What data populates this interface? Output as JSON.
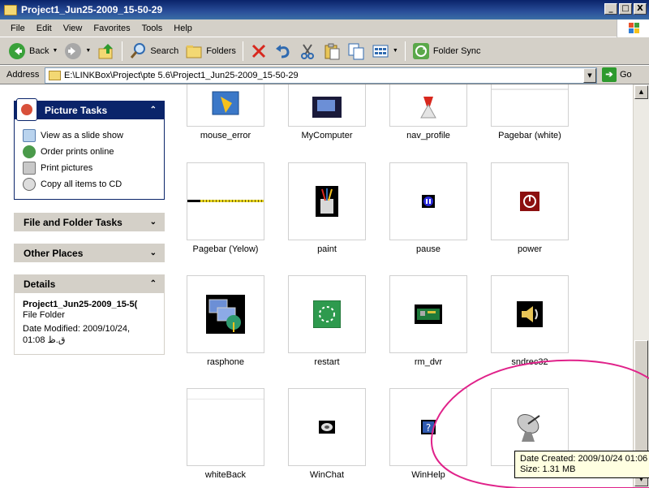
{
  "window": {
    "title": "Project1_Jun25-2009_15-50-29",
    "controls": [
      "_",
      "□",
      "X"
    ]
  },
  "menubar": {
    "items": [
      "File",
      "Edit",
      "View",
      "Favorites",
      "Tools",
      "Help"
    ]
  },
  "toolbar": {
    "back_label": "Back",
    "search_label": "Search",
    "folders_label": "Folders",
    "folder_sync_label": "Folder Sync"
  },
  "address": {
    "label": "Address",
    "path": "E:\\LINKBox\\Project\\pte 5.6\\Project1_Jun25-2009_15-50-29",
    "go_label": "Go"
  },
  "sidebar": {
    "picture_tasks": {
      "title": "Picture Tasks",
      "items": [
        {
          "label": "View as a slide show",
          "icon": "slideshow-icon"
        },
        {
          "label": "Order prints online",
          "icon": "globe-icon"
        },
        {
          "label": "Print pictures",
          "icon": "printer-icon"
        },
        {
          "label": "Copy all items to CD",
          "icon": "cd-icon"
        }
      ]
    },
    "file_folder_tasks": {
      "title": "File and Folder Tasks"
    },
    "other_places": {
      "title": "Other Places"
    },
    "details": {
      "title": "Details",
      "name": "Project1_Jun25-2009_15-5(",
      "type": "File Folder",
      "modified_line1": "Date Modified: 2009/10/24,",
      "modified_line2": "01:08 ق.ظ"
    }
  },
  "files": [
    {
      "name": "mouse_error"
    },
    {
      "name": "MyComputer"
    },
    {
      "name": "nav_profile"
    },
    {
      "name": "Pagebar (white)"
    },
    {
      "name": "Pagebar (Yelow)"
    },
    {
      "name": "paint"
    },
    {
      "name": "pause"
    },
    {
      "name": "power"
    },
    {
      "name": "rasphone"
    },
    {
      "name": "restart"
    },
    {
      "name": "rm_dvr"
    },
    {
      "name": "sndrec32"
    },
    {
      "name": "whiteBack"
    },
    {
      "name": "WinChat"
    },
    {
      "name": "WinHelp"
    },
    {
      "name": ""
    }
  ],
  "tooltip": {
    "line1": "Date Created: 2009/10/24 01:06",
    "line2": "Size: 1.31 MB"
  },
  "colors": {
    "title_bar": "#0a246a",
    "chrome": "#d4d0c8",
    "annotation": "#e0228a"
  }
}
